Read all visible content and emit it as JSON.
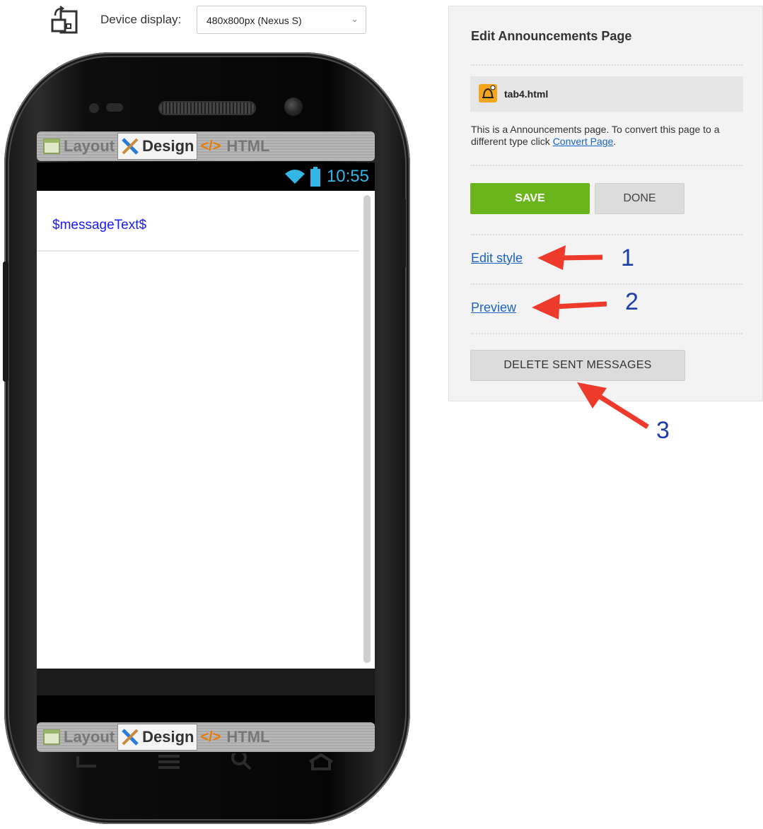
{
  "toolbar": {
    "rotate_icon": "rotate-device-icon",
    "device_label": "Device display:",
    "device_value": "480x800px (Nexus S)"
  },
  "phone": {
    "modes": {
      "layout": "Layout",
      "design": "Design",
      "html_code": "</>",
      "html": "HTML"
    },
    "status_time": "10:55",
    "message_text": "$messageText$",
    "nav_icons": [
      "back-icon",
      "menu-icon",
      "search-icon",
      "home-icon"
    ]
  },
  "panel": {
    "title": "Edit Announcements Page",
    "file_name": "tab4.html",
    "file_icon": "announcement-bell-icon",
    "desc_prefix": "This is a Announcements page. To convert this page to a different type click ",
    "desc_link": "Convert Page",
    "desc_suffix": ".",
    "save": "SAVE",
    "done": "DONE",
    "edit_style": "Edit style",
    "preview": "Preview",
    "delete_sent": "DELETE SENT MESSAGES"
  },
  "callouts": [
    "1",
    "2",
    "3"
  ],
  "colors": {
    "save_green": "#6bb51c",
    "link_blue": "#1b63c6",
    "arrow_red": "#ee3a2a",
    "status_blue": "#33b5e5"
  }
}
